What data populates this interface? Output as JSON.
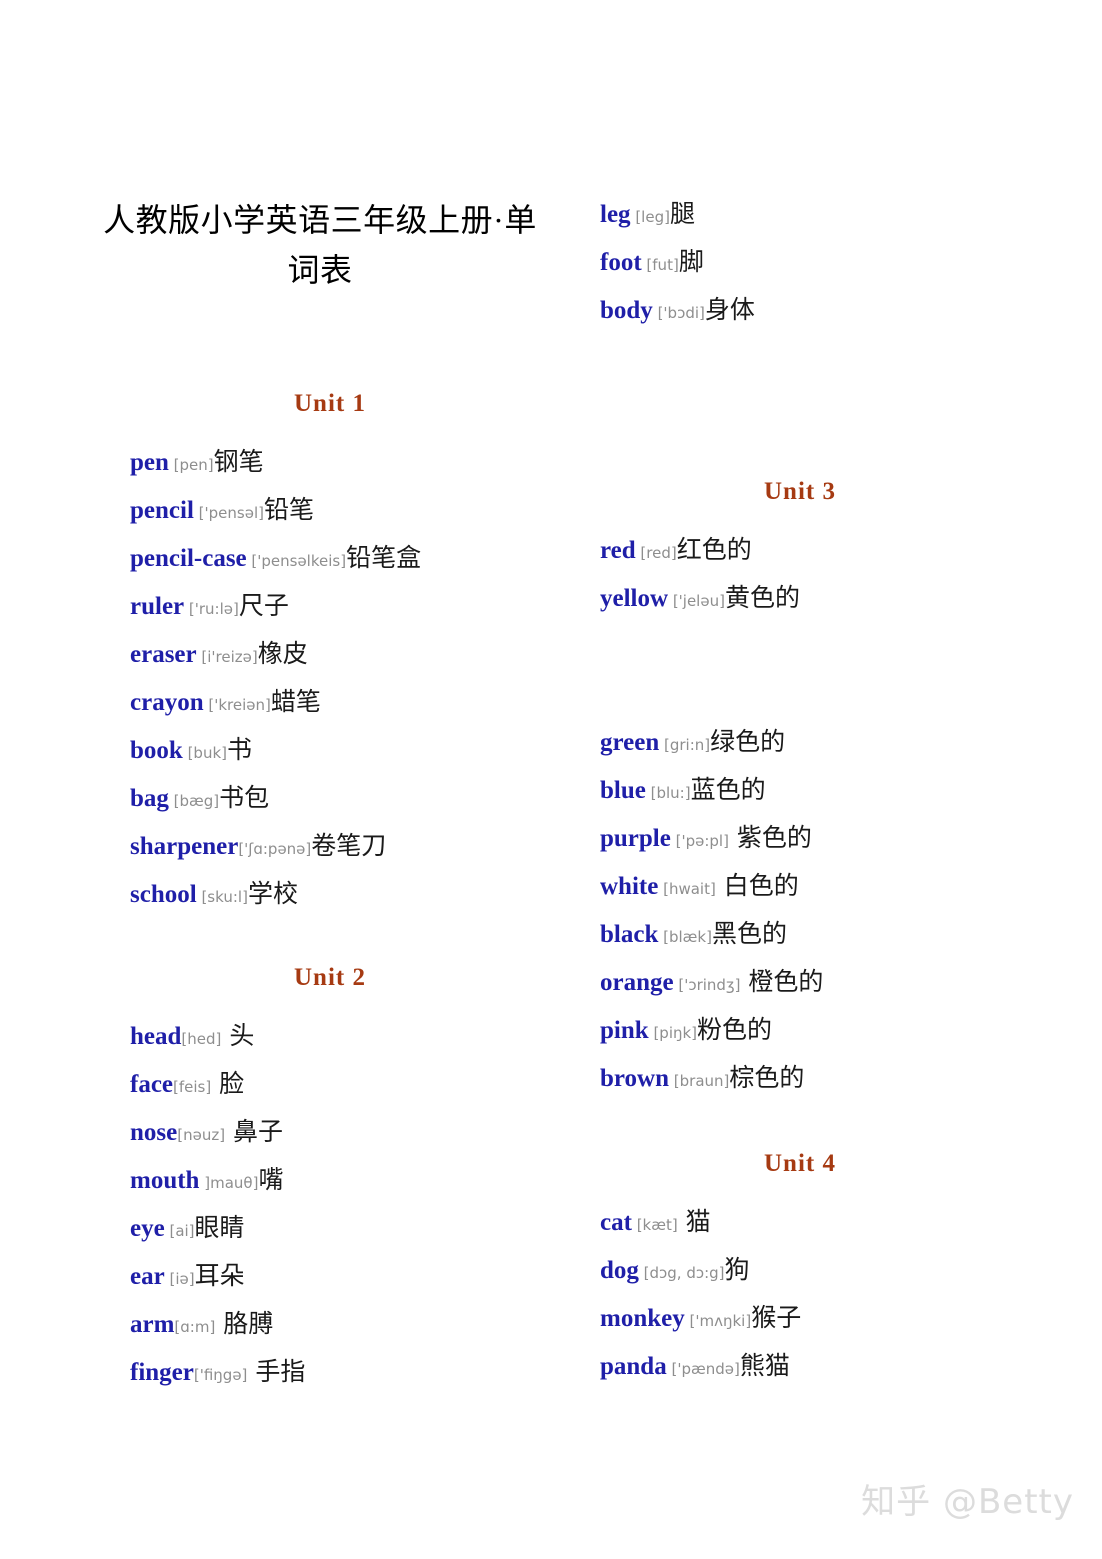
{
  "document": {
    "title_line1": "人教版小学英语三年级上册·单",
    "title_line2": "词表",
    "watermark": "知乎 @Betty"
  },
  "colors": {
    "heading": "#a63a12",
    "word": "#1f1fa8",
    "phonetic": "#8e8e8e",
    "chinese": "#1a1a1a",
    "title": "#000000",
    "watermark": "#dcdcdc",
    "background": "#ffffff"
  },
  "left_column": {
    "unit1_heading": "Unit  1",
    "unit1_entries": [
      {
        "word": "pen",
        "phonetic": " [pen]",
        "chinese": "钢笔"
      },
      {
        "word": "pencil",
        "phonetic": " ['pensəl]",
        "chinese": "铅笔"
      },
      {
        "word": "pencil-case",
        "phonetic": " ['pensəlkeis]",
        "chinese": "铅笔盒"
      },
      {
        "word": "ruler",
        "phonetic": " ['ru:lə]",
        "chinese": "尺子"
      },
      {
        "word": "eraser",
        "phonetic": " [i'reizə]",
        "chinese": "橡皮"
      },
      {
        "word": "crayon",
        "phonetic": " ['kreiən]",
        "chinese": "蜡笔"
      },
      {
        "word": "book",
        "phonetic": " [buk]",
        "chinese": "书"
      },
      {
        "word": "bag",
        "phonetic": " [bæg]",
        "chinese": "书包"
      },
      {
        "word": "sharpener",
        "phonetic": "['ʃɑ:pənə]",
        "chinese": "卷笔刀"
      },
      {
        "word": "school",
        "phonetic": " [sku:l]",
        "chinese": "学校"
      }
    ],
    "unit2_heading": "Unit  2",
    "unit2_entries": [
      {
        "word": "head",
        "phonetic": "[hed]",
        "chinese": "  头"
      },
      {
        "word": "face",
        "phonetic": "[feis]",
        "chinese": " 脸"
      },
      {
        "word": "nose",
        "phonetic": "[nəuz]",
        "chinese": " 鼻子"
      },
      {
        "word": "mouth",
        "phonetic": " ]mauθ]",
        "chinese": "嘴"
      },
      {
        "word": "eye",
        "phonetic": " [ai]",
        "chinese": "眼睛"
      },
      {
        "word": "ear",
        "phonetic": " [iə]",
        "chinese": "耳朵"
      },
      {
        "word": "arm",
        "phonetic": "[ɑ:m]",
        "chinese": "  胳膊"
      },
      {
        "word": "finger",
        "phonetic": "['fiŋgə]",
        "chinese": " 手指"
      }
    ]
  },
  "right_column": {
    "unit2_continued_entries": [
      {
        "word": "leg",
        "phonetic": " [leg]",
        "chinese": "腿"
      },
      {
        "word": "foot",
        "phonetic": " [fut]",
        "chinese": "脚"
      },
      {
        "word": "body",
        "phonetic": " ['bɔdi]",
        "chinese": "身体"
      }
    ],
    "unit3_heading": "Unit  3",
    "unit3_entries_part1": [
      {
        "word": "red",
        "phonetic": " [red]",
        "chinese": "红色的"
      },
      {
        "word": "yellow",
        "phonetic": " ['jeləu]",
        "chinese": "黄色的"
      }
    ],
    "unit3_entries_part2": [
      {
        "word": "green",
        "phonetic": " [gri:n]",
        "chinese": "绿色的"
      },
      {
        "word": "blue",
        "phonetic": " [blu:]",
        "chinese": "蓝色的"
      },
      {
        "word": "purple",
        "phonetic": " ['pə:pl]",
        "chinese": " 紫色的"
      },
      {
        "word": "white",
        "phonetic": " [hwait]",
        "chinese": " 白色的"
      },
      {
        "word": "black",
        "phonetic": " [blæk]",
        "chinese": "黑色的"
      },
      {
        "word": "orange",
        "phonetic": " ['ɔrindʒ]",
        "chinese": " 橙色的"
      },
      {
        "word": "pink",
        "phonetic": " [piŋk]",
        "chinese": "粉色的"
      },
      {
        "word": "brown",
        "phonetic": " [braun]",
        "chinese": "棕色的"
      }
    ],
    "unit4_heading": "Unit  4",
    "unit4_entries": [
      {
        "word": "cat",
        "phonetic": " [kæt]",
        "chinese": " 猫"
      },
      {
        "word": "dog",
        "phonetic": " [dɔg, dɔ:g]",
        "chinese": "狗"
      },
      {
        "word": "monkey",
        "phonetic": " ['mʌŋki]",
        "chinese": "猴子"
      },
      {
        "word": "panda",
        "phonetic": " ['pændə]",
        "chinese": "熊猫"
      }
    ]
  }
}
